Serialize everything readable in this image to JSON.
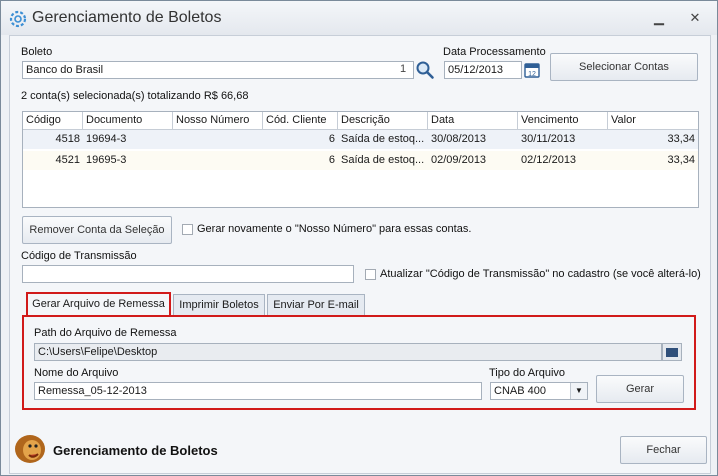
{
  "window": {
    "title": "Gerenciamento de Boletos",
    "min_glyph": "▁",
    "close_glyph": "✕"
  },
  "boleto": {
    "label": "Boleto",
    "value": "Banco do Brasil",
    "count": "1"
  },
  "data_processamento": {
    "label": "Data Processamento",
    "value": "05/12/2013"
  },
  "buttons": {
    "selecionar_contas": "Selecionar Contas",
    "remover_conta": "Remover Conta da Seleção",
    "gerar": "Gerar",
    "fechar": "Fechar"
  },
  "summary": "2 conta(s) selecionada(s) totalizando R$ 66,68",
  "table": {
    "columns": [
      "Código",
      "Documento",
      "Nosso Número",
      "Cód. Cliente",
      "Descrição",
      "Data",
      "Vencimento",
      "Valor"
    ],
    "rows": [
      {
        "codigo": "4518",
        "documento": "19694-3",
        "nosso_numero": "",
        "cod_cliente": "6",
        "descricao": "Saída de estoq...",
        "data": "30/08/2013",
        "vencimento": "30/11/2013",
        "valor": "33,34"
      },
      {
        "codigo": "4521",
        "documento": "19695-3",
        "nosso_numero": "",
        "cod_cliente": "6",
        "descricao": "Saída de estoq...",
        "data": "02/09/2013",
        "vencimento": "02/12/2013",
        "valor": "33,34"
      }
    ]
  },
  "gerar_novamente": {
    "label": "Gerar novamente o \"Nosso Número\" para essas contas.",
    "checked": false
  },
  "codigo_transmissao": {
    "label": "Código de Transmissão",
    "value": ""
  },
  "atualizar_codigo": {
    "label": "Atualizar \"Código de Transmissão\" no cadastro (se você alterá-lo)",
    "checked": false
  },
  "tabs": [
    "Gerar Arquivo de Remessa",
    "Imprimir Boletos",
    "Enviar Por E-mail"
  ],
  "remessa": {
    "path_label": "Path do Arquivo de Remessa",
    "path_value": "C:\\Users\\Felipe\\Desktop",
    "nome_label": "Nome do Arquivo",
    "nome_value": "Remessa_05-12-2013",
    "tipo_label": "Tipo do Arquivo",
    "tipo_value": "CNAB 400"
  },
  "footer": {
    "title": "Gerenciamento de Boletos"
  },
  "colors": {
    "highlight_border": "#d11a1a",
    "row_alt": "#fdfbf3",
    "row_sel": "#eef2f8"
  }
}
